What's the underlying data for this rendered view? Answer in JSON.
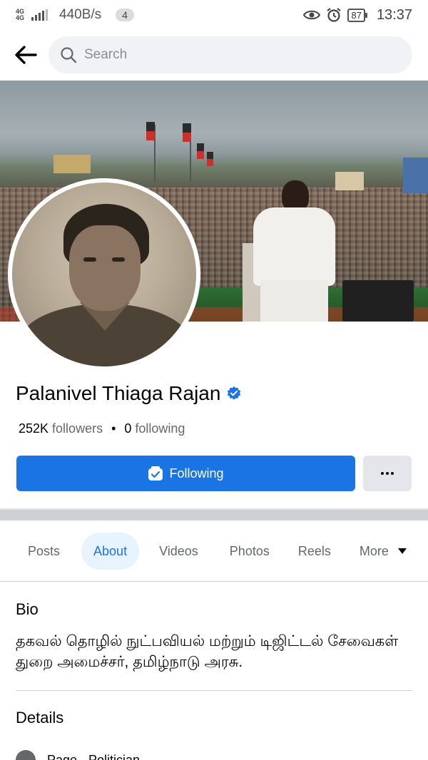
{
  "status_bar": {
    "network_type": "4G",
    "network_sub": "4G",
    "speed": "440B/s",
    "notification_count": "4",
    "battery": "87",
    "time": "13:37"
  },
  "header": {
    "search_placeholder": "Search"
  },
  "profile": {
    "name": "Palanivel Thiaga Rajan",
    "followers_count": "252K",
    "followers_label": "followers",
    "separator": "•",
    "following_count": "0",
    "following_label": "following",
    "following_button": "Following",
    "accent_color": "#1b74e4"
  },
  "tabs": [
    {
      "label": "Posts",
      "active": false
    },
    {
      "label": "About",
      "active": true
    },
    {
      "label": "Videos",
      "active": false
    },
    {
      "label": "Photos",
      "active": false
    },
    {
      "label": "Reels",
      "active": false
    },
    {
      "label": "More",
      "active": false
    }
  ],
  "bio": {
    "title": "Bio",
    "text": "தகவல் தொழில் நுட்பவியல் மற்றும் டிஜிட்டல் சேவைகள் துறை அமைச்சர், தமிழ்நாடு அரசு."
  },
  "details": {
    "title": "Details",
    "first_item": "Page · Politician"
  }
}
